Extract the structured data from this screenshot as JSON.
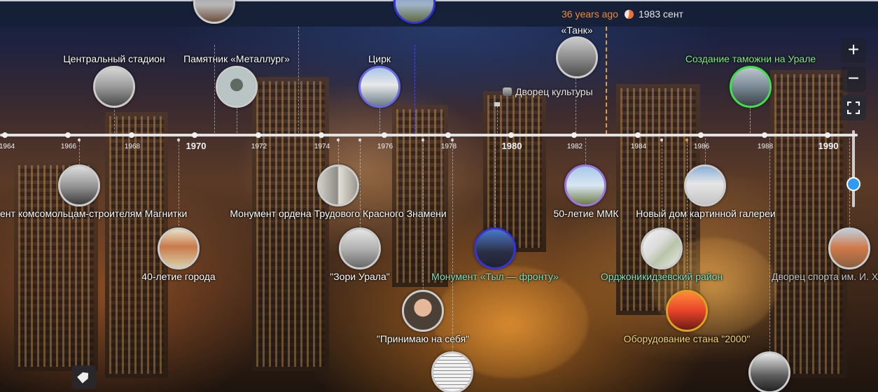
{
  "header": {
    "time_ago": "36 years ago",
    "current_date": "1983 сент"
  },
  "axis": {
    "labels": [
      {
        "text": "1964",
        "major": false
      },
      {
        "text": "1966",
        "major": false
      },
      {
        "text": "1968",
        "major": false
      },
      {
        "text": "1970",
        "major": true
      },
      {
        "text": "1972",
        "major": false
      },
      {
        "text": "1974",
        "major": false
      },
      {
        "text": "1976",
        "major": false
      },
      {
        "text": "1978",
        "major": false
      },
      {
        "text": "1980",
        "major": true
      },
      {
        "text": "1982",
        "major": false
      },
      {
        "text": "1984",
        "major": false
      },
      {
        "text": "1986",
        "major": false
      },
      {
        "text": "1988",
        "major": false
      },
      {
        "text": "1990",
        "major": true
      }
    ]
  },
  "events": {
    "central_stadium": "Центральный стадион",
    "monument_metallurg": "Памятник «Металлург»",
    "circus": "Цирк",
    "tank": "«Танк»",
    "palace_of_culture": "Дворец культуры",
    "customs_ural": "Создание таможни на Урале",
    "komsomol_monument": "ент  комсомольцам-строителям Магнитки",
    "order_monument": "Монумент ордена Трудового Красного Знамени",
    "mmk_50": "50-летие ММК",
    "gallery_house": "Новый дом картинной галереи",
    "city_40": "40-летие города",
    "zori_urala": "\"Зори Урала\"",
    "tyl_frontu": "Монумент «Тыл — фронту»",
    "ordzhonikidze": "Орджоникидзевский район",
    "sports_palace": "Дворец спорта им. И. Х",
    "accept_myself": "\"Принимаю на себя\"",
    "mill_2000": "Оборудование стана \"2000\""
  },
  "controls": {
    "zoom_in": "+",
    "zoom_out": "−"
  },
  "colors": {
    "accent_orange": "#f08a2c",
    "accent_green": "#3fe04a",
    "accent_blue": "#2f9bf0",
    "topbar_bg": "#162036"
  }
}
